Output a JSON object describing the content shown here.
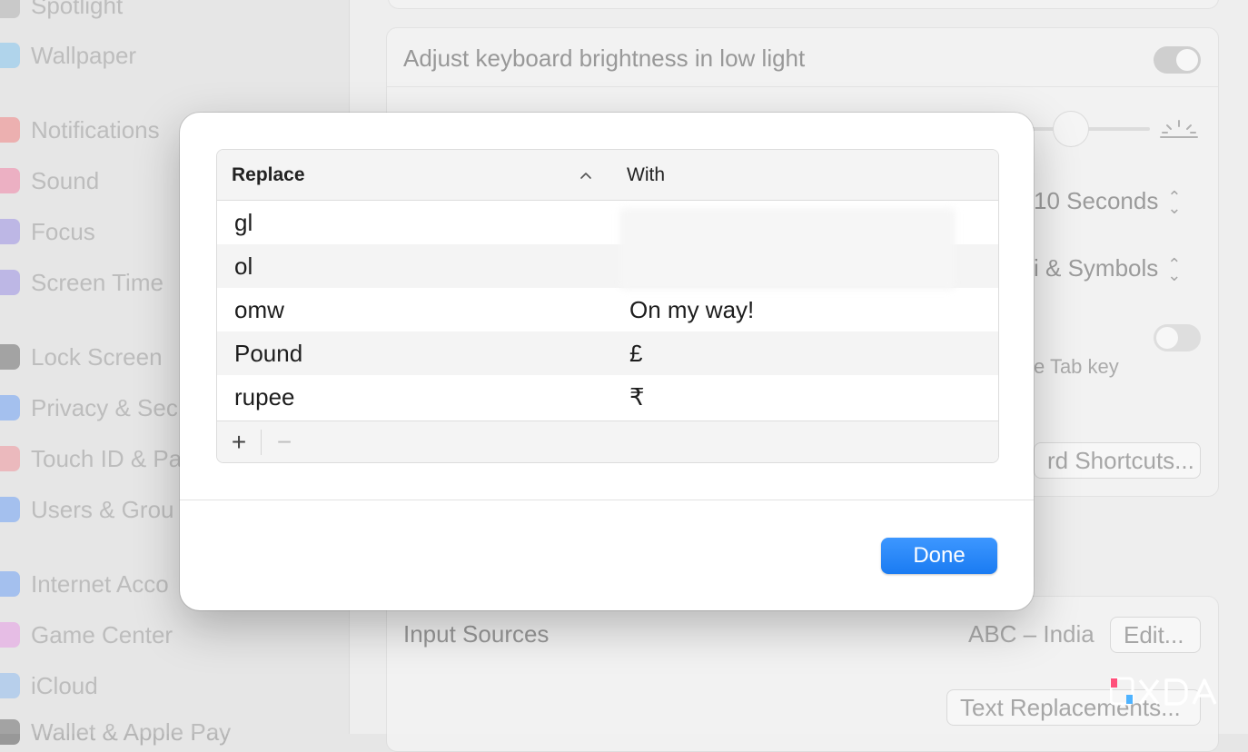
{
  "sidebar": {
    "items": [
      {
        "label": "Spotlight",
        "icon": "spotlight-icon",
        "color": "#9a9a9a"
      },
      {
        "label": "Wallpaper",
        "icon": "wallpaper-icon",
        "color": "#5ab4f0"
      },
      {
        "label": "Notifications",
        "icon": "notifications-icon",
        "color": "#f25a5a"
      },
      {
        "label": "Sound",
        "icon": "sound-icon",
        "color": "#f25a8a"
      },
      {
        "label": "Focus",
        "icon": "focus-icon",
        "color": "#7a6ae0"
      },
      {
        "label": "Screen Time",
        "icon": "screen-time-icon",
        "color": "#7a6ae0"
      },
      {
        "label": "Lock Screen",
        "icon": "lock-screen-icon",
        "color": "#3a3a3a"
      },
      {
        "label": "Privacy & Sec",
        "icon": "privacy-icon",
        "color": "#3b82f6"
      },
      {
        "label": "Touch ID & Pa",
        "icon": "touch-id-icon",
        "color": "#f0707a"
      },
      {
        "label": "Users & Grou",
        "icon": "users-icon",
        "color": "#3b82f6"
      },
      {
        "label": "Internet Acco",
        "icon": "internet-accounts-icon",
        "color": "#3b82f6"
      },
      {
        "label": "Game Center",
        "icon": "game-center-icon",
        "color": "#e27adf"
      },
      {
        "label": "iCloud",
        "icon": "icloud-icon",
        "color": "#6aa8f0"
      },
      {
        "label": "Wallet & Apple Pay",
        "icon": "wallet-icon",
        "color": "#3a3a3a"
      }
    ]
  },
  "background": {
    "keyboard_brightness_label": "Adjust keyboard brightness in low light",
    "backlight_off_value": "10 Seconds",
    "press_key_value": "i & Symbols",
    "tab_key_label": "e Tab key",
    "keyboard_shortcuts_button": "rd Shortcuts...",
    "input_sources_label": "Input Sources",
    "input_sources_value": "ABC – India",
    "edit_button": "Edit...",
    "text_replacements_button": "Text Replacements..."
  },
  "dialog": {
    "columns": {
      "replace": "Replace",
      "with": "With"
    },
    "rows": [
      {
        "replace": "gl",
        "with": ""
      },
      {
        "replace": "ol",
        "with": ""
      },
      {
        "replace": "omw",
        "with": "On my way!"
      },
      {
        "replace": "Pound",
        "with": "£"
      },
      {
        "replace": "rupee",
        "with": "₹"
      }
    ],
    "add_label": "+",
    "remove_label": "−",
    "done_label": "Done"
  },
  "colors": {
    "accent": "#1a7bf2"
  },
  "watermark": "XDA"
}
